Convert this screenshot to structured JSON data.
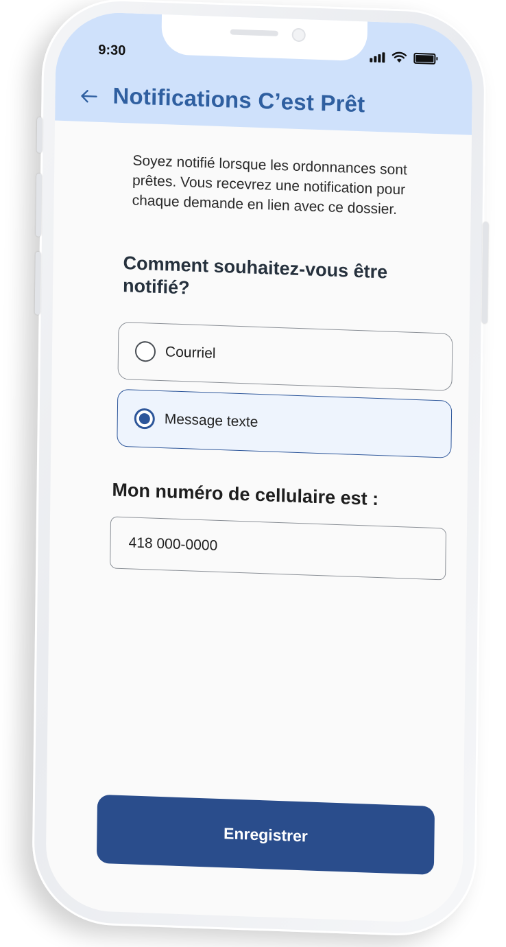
{
  "status_bar": {
    "time": "9:30",
    "icons": [
      "signal-icon",
      "wifi-icon",
      "battery-icon"
    ]
  },
  "header": {
    "back_icon": "arrow-left-icon",
    "title": "Notifications C’est Prêt"
  },
  "content": {
    "description": "Soyez notifié lorsque les ordonnances sont prêtes. Vous recevrez une notification pour chaque demande en lien avec ce dossier.",
    "question": "Comment souhaitez-vous être notifié?",
    "options": [
      {
        "label": "Courriel",
        "selected": false
      },
      {
        "label": "Message texte",
        "selected": true
      }
    ],
    "phone_label": "Mon numéro de cellulaire est :",
    "phone_value": "418 000-0000"
  },
  "actions": {
    "save_label": "Enregistrer"
  },
  "colors": {
    "header_bg": "#cfe1fb",
    "title": "#2f5fa0",
    "accent": "#2d569a",
    "button_bg": "#2a4d8c",
    "selected_bg": "#eef4fd"
  }
}
